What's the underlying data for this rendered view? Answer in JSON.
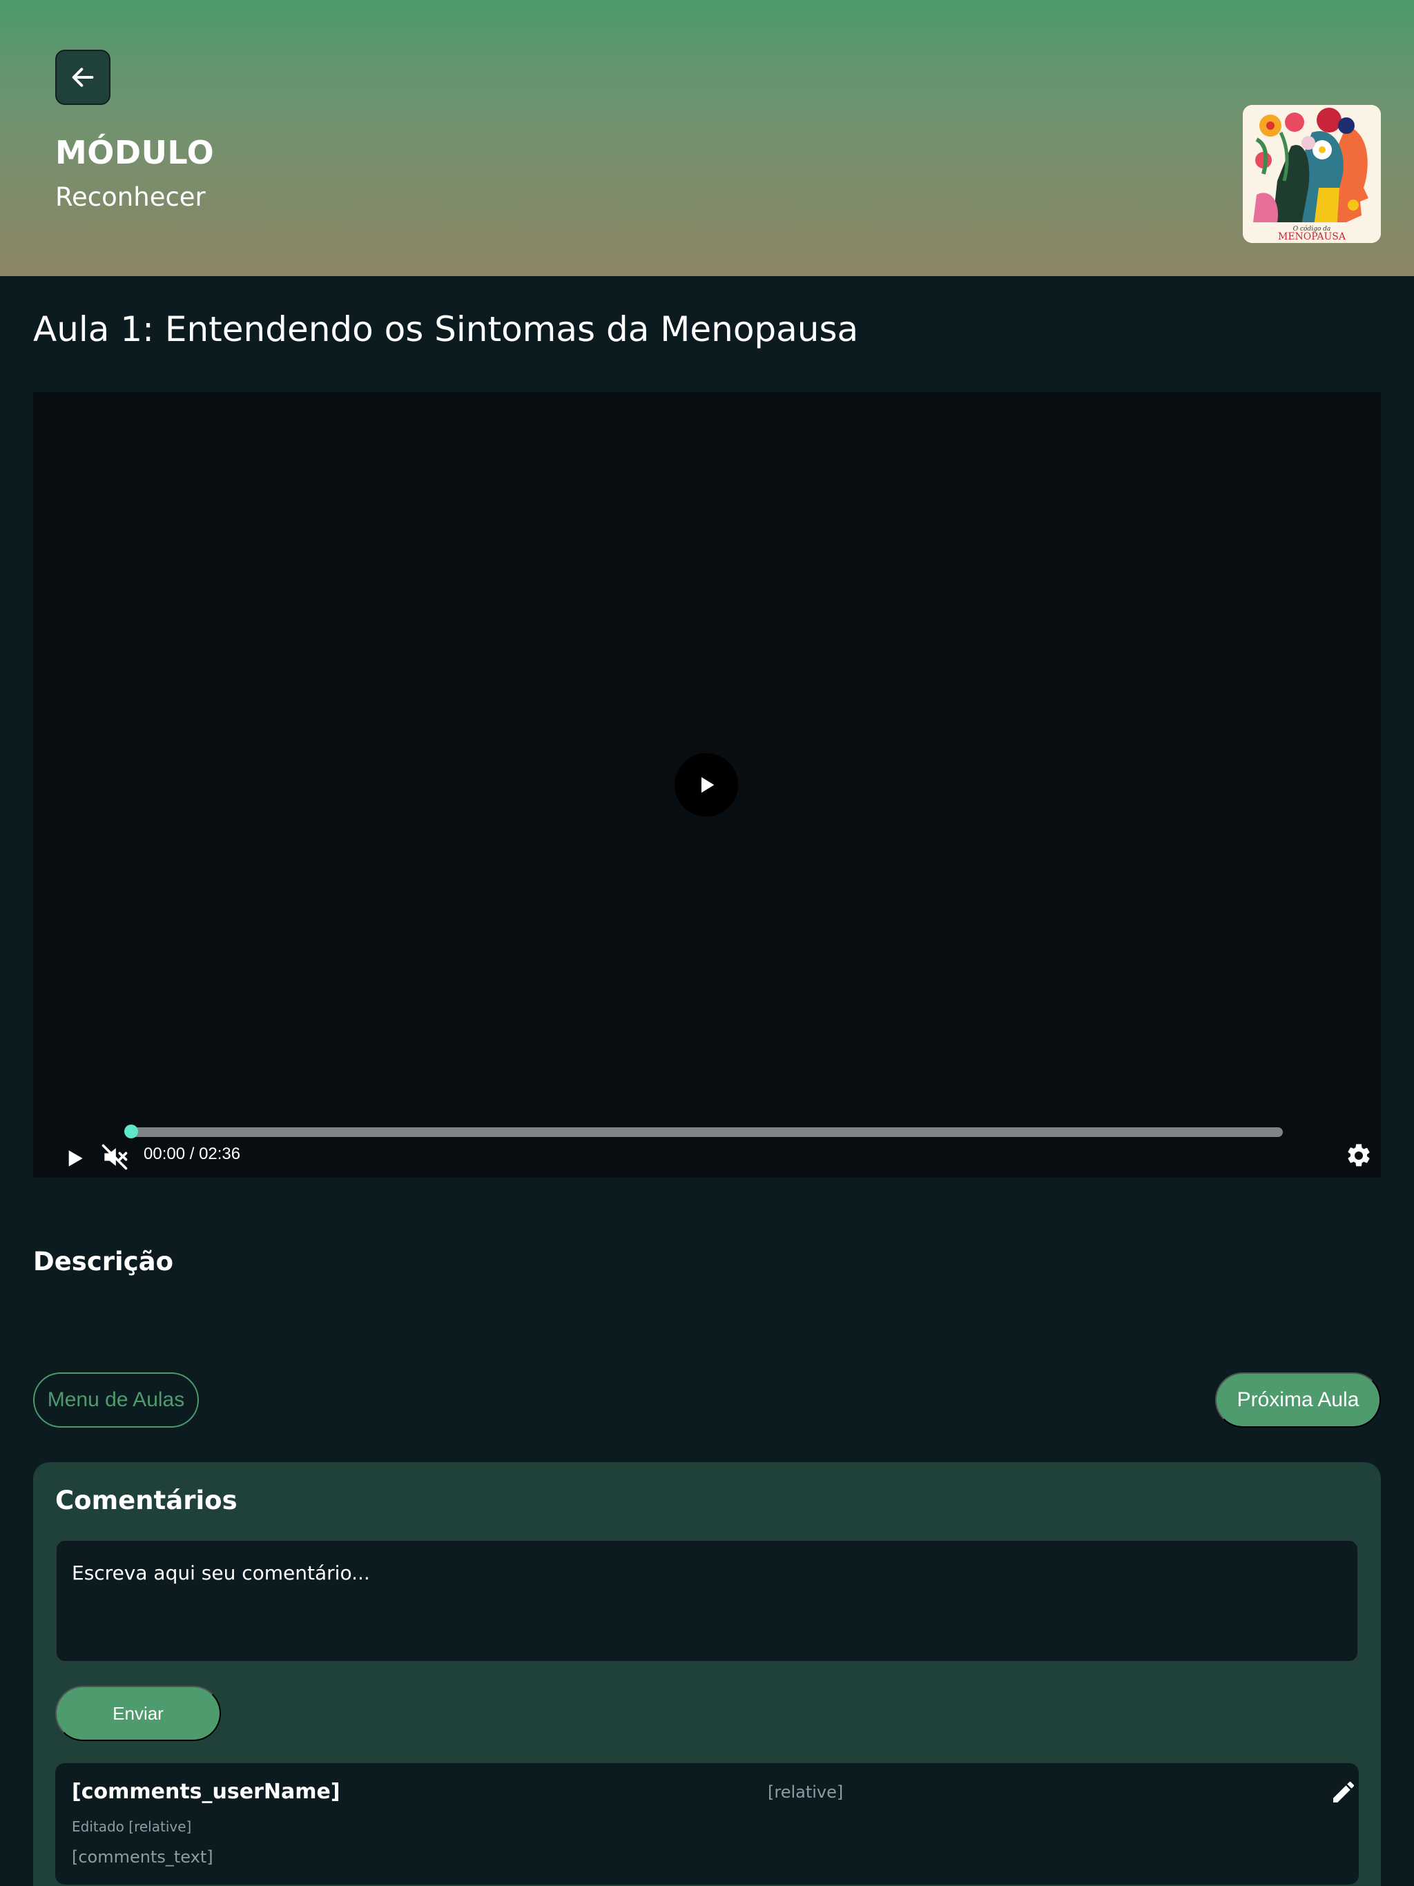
{
  "header": {
    "module_label": "MÓDULO",
    "module_name": "Reconhecer",
    "cover_image": "book-cover-image"
  },
  "lesson": {
    "title": "Aula 1: Entendendo os Sintomas da Menopausa"
  },
  "video": {
    "time_display": "00:00 / 02:36",
    "progress": 0,
    "muted": true,
    "accent_color": "#5fe8c8"
  },
  "description": {
    "title": "Descrição"
  },
  "navigation": {
    "menu_label": "Menu de Aulas",
    "next_label": "Próxima Aula"
  },
  "comments": {
    "title": "Comentários",
    "input_placeholder": "Escreva aqui seu comentário...",
    "send_label": "Enviar",
    "items": [
      {
        "user_name": "[comments_userName]",
        "time": "[relative]",
        "edited": "Editado [relative]",
        "text": "[comments_text]"
      }
    ]
  },
  "colors": {
    "brand_green": "#4e9c6e",
    "background": "#0c1b20",
    "card_background": "#20413a"
  }
}
